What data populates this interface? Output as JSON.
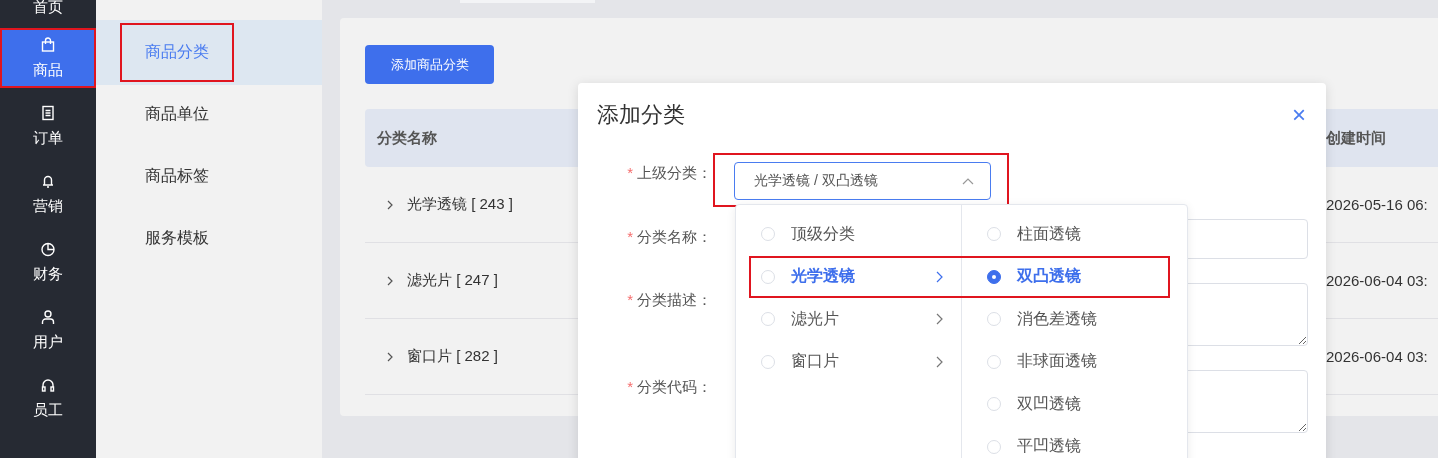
{
  "sidebar": {
    "items": [
      {
        "label": "首页",
        "selected": false,
        "highlighted": false
      },
      {
        "label": "商品",
        "selected": true,
        "highlighted": true
      },
      {
        "label": "订单",
        "selected": false,
        "highlighted": false
      },
      {
        "label": "营销",
        "selected": false,
        "highlighted": false
      },
      {
        "label": "财务",
        "selected": false,
        "highlighted": false
      },
      {
        "label": "用户",
        "selected": false,
        "highlighted": false
      },
      {
        "label": "员工",
        "selected": false,
        "highlighted": false
      }
    ]
  },
  "submenu": {
    "items": [
      {
        "label": "商品分类",
        "selected": true,
        "highlighted": true
      },
      {
        "label": "商品单位",
        "selected": false,
        "highlighted": false
      },
      {
        "label": "商品标签",
        "selected": false,
        "highlighted": false
      },
      {
        "label": "服务模板",
        "selected": false,
        "highlighted": false
      }
    ]
  },
  "add_button": "添加商品分类",
  "table": {
    "columns": [
      "分类名称",
      "创建时间"
    ],
    "rows": [
      {
        "name": "光学透镜 [ 243 ]",
        "created": "2026-05-16 06:"
      },
      {
        "name": "滤光片 [ 247 ]",
        "created": "2026-06-04 03:"
      },
      {
        "name": "窗口片 [ 282 ]",
        "created": "2026-06-04 03:"
      }
    ]
  },
  "dialog": {
    "title": "添加分类",
    "close": "×",
    "fields": [
      {
        "label": "上级分类：",
        "required_mark": "*",
        "kind": "select",
        "value": "光学透镜 / 双凸透镜",
        "highlighted": true
      },
      {
        "label": "分类名称：",
        "required_mark": "*",
        "kind": "input",
        "highlighted": false
      },
      {
        "label": "分类描述：",
        "required_mark": "*",
        "kind": "textarea",
        "highlighted": false
      },
      {
        "label": "分类代码：",
        "required_mark": "*",
        "kind": "textarea",
        "highlighted": false
      }
    ]
  },
  "cascader": {
    "columns": [
      {
        "options": [
          {
            "label": "顶级分类",
            "selected": false,
            "expanded": false,
            "has_children": false,
            "highlighted": false
          },
          {
            "label": "光学透镜",
            "selected": false,
            "expanded": true,
            "has_children": true,
            "highlighted": true
          },
          {
            "label": "滤光片",
            "selected": false,
            "expanded": false,
            "has_children": true,
            "highlighted": false
          },
          {
            "label": "窗口片",
            "selected": false,
            "expanded": false,
            "has_children": true,
            "highlighted": false
          }
        ]
      },
      {
        "options": [
          {
            "label": "柱面透镜",
            "selected": false,
            "expanded": false,
            "has_children": false,
            "highlighted": false
          },
          {
            "label": "双凸透镜",
            "selected": true,
            "expanded": false,
            "has_children": false,
            "highlighted": true
          },
          {
            "label": "消色差透镜",
            "selected": false,
            "expanded": false,
            "has_children": false,
            "highlighted": false
          },
          {
            "label": "非球面透镜",
            "selected": false,
            "expanded": false,
            "has_children": false,
            "highlighted": false
          },
          {
            "label": "双凹透镜",
            "selected": false,
            "expanded": false,
            "has_children": false,
            "highlighted": false
          },
          {
            "label": "平凹透镜",
            "selected": false,
            "expanded": false,
            "has_children": false,
            "highlighted": false
          }
        ]
      }
    ]
  }
}
